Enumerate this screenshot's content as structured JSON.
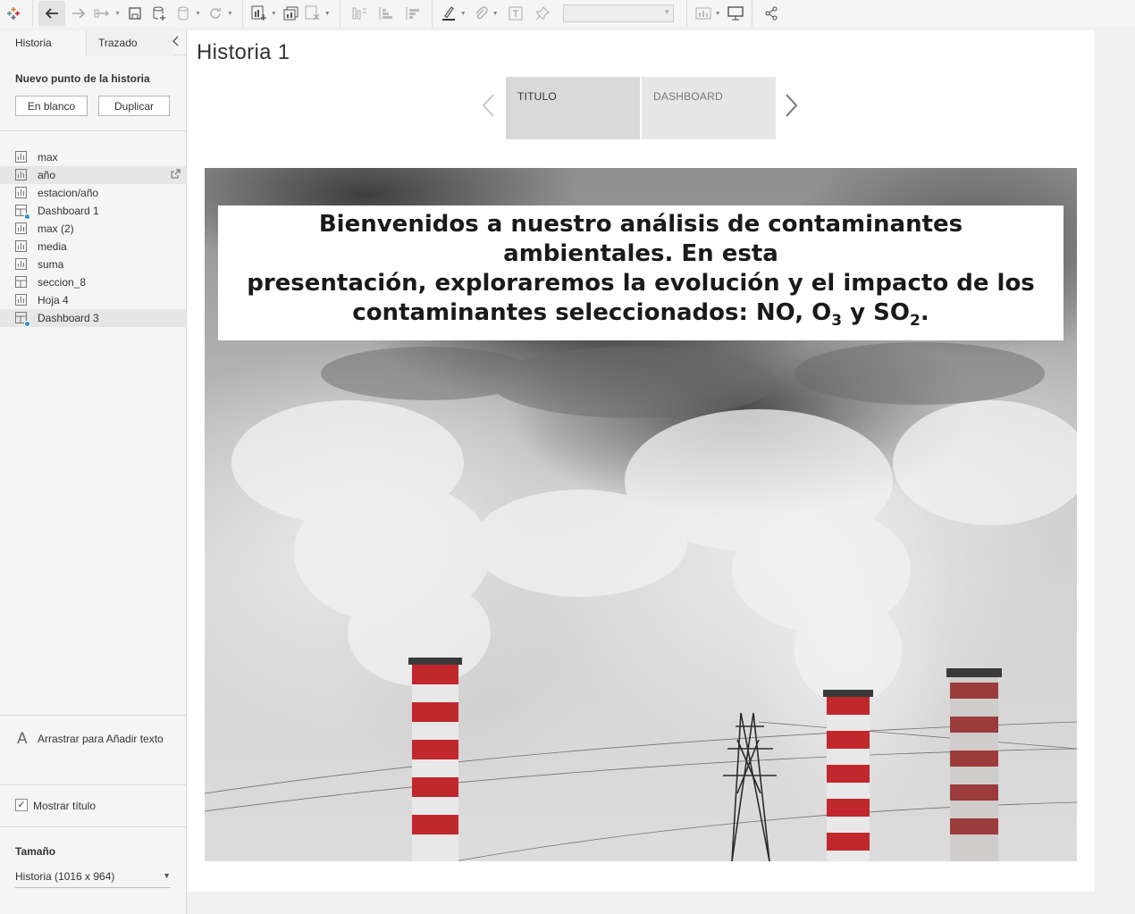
{
  "toolbar": {
    "icons": [
      "tableau-logo-icon",
      "undo-icon",
      "redo-icon",
      "swap-icon",
      "save-icon",
      "new-datasource-icon",
      "pause-updates-icon",
      "refresh-icon",
      "new-worksheet-icon",
      "duplicate-sheet-icon",
      "clear-sheet-icon",
      "swap-axes-icon",
      "sort-ascending-icon",
      "sort-descending-icon",
      "highlight-icon",
      "group-icon",
      "show-labels-icon",
      "pin-icon",
      "fit-dropdown",
      "show-me-icon",
      "presentation-icon",
      "share-icon"
    ]
  },
  "sidebar": {
    "tabs": [
      {
        "label": "Historia"
      },
      {
        "label": "Trazado"
      }
    ],
    "new_point_title": "Nuevo punto de la historia",
    "buttons": {
      "blank": "En blanco",
      "duplicate": "Duplicar"
    },
    "sheets": [
      {
        "label": "max",
        "type": "worksheet"
      },
      {
        "label": "año",
        "type": "worksheet"
      },
      {
        "label": "estacion/año",
        "type": "worksheet"
      },
      {
        "label": "Dashboard 1",
        "type": "dashboard"
      },
      {
        "label": "max (2)",
        "type": "worksheet"
      },
      {
        "label": "media",
        "type": "worksheet"
      },
      {
        "label": "suma",
        "type": "worksheet"
      },
      {
        "label": "seccion_8",
        "type": "dashboard"
      },
      {
        "label": "Hoja 4",
        "type": "worksheet"
      },
      {
        "label": "Dashboard 3",
        "type": "dashboard"
      }
    ],
    "drag_text_label": "Arrastrar para Añadir texto",
    "show_title_label": "Mostrar título",
    "show_title_checked": true,
    "size_title": "Tamaño",
    "size_value": "Historia (1016 x 964)"
  },
  "story": {
    "title": "Historia 1",
    "points": [
      {
        "label": "TITULO",
        "selected": true
      },
      {
        "label": "DASHBOARD",
        "selected": false
      }
    ],
    "caption_line1": "Bienvenidos a nuestro análisis de contaminantes ambientales. En esta",
    "caption_line2": "presentación, exploraremos la evolución y el impacto de los",
    "caption_line3_prefix": "contaminantes seleccionados: NO, O",
    "caption_sub1": "3",
    "caption_mid": " y SO",
    "caption_sub2": "2",
    "caption_end": "."
  },
  "colors": {
    "accent_blue": "#2f8fd3",
    "chimney_red": "#c0282d",
    "chimney_white": "#e8e8e8"
  }
}
